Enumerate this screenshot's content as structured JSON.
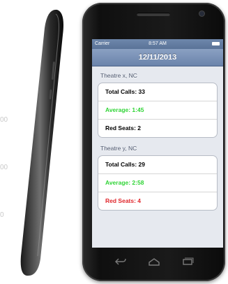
{
  "background": {
    "ticks": [
      "00",
      "00",
      "0"
    ]
  },
  "status_bar": {
    "carrier": "Carrier",
    "time": "8:57 AM"
  },
  "nav": {
    "title": "12/11/2013"
  },
  "sections": [
    {
      "header": "Theatre x, NC",
      "rows": [
        {
          "label": "Total Calls: 33",
          "color": "#000000"
        },
        {
          "label": "Average: 1:45",
          "color": "#30d436"
        },
        {
          "label": "Red Seats: 2",
          "color": "#000000"
        }
      ]
    },
    {
      "header": "Theatre y, NC",
      "rows": [
        {
          "label": "Total Calls: 29",
          "color": "#000000"
        },
        {
          "label": "Average: 2:58",
          "color": "#30d436"
        },
        {
          "label": "Red Seats: 4",
          "color": "#e0262b"
        }
      ]
    }
  ],
  "hardware_buttons": [
    "back-icon",
    "home-icon",
    "recent-apps-icon"
  ]
}
